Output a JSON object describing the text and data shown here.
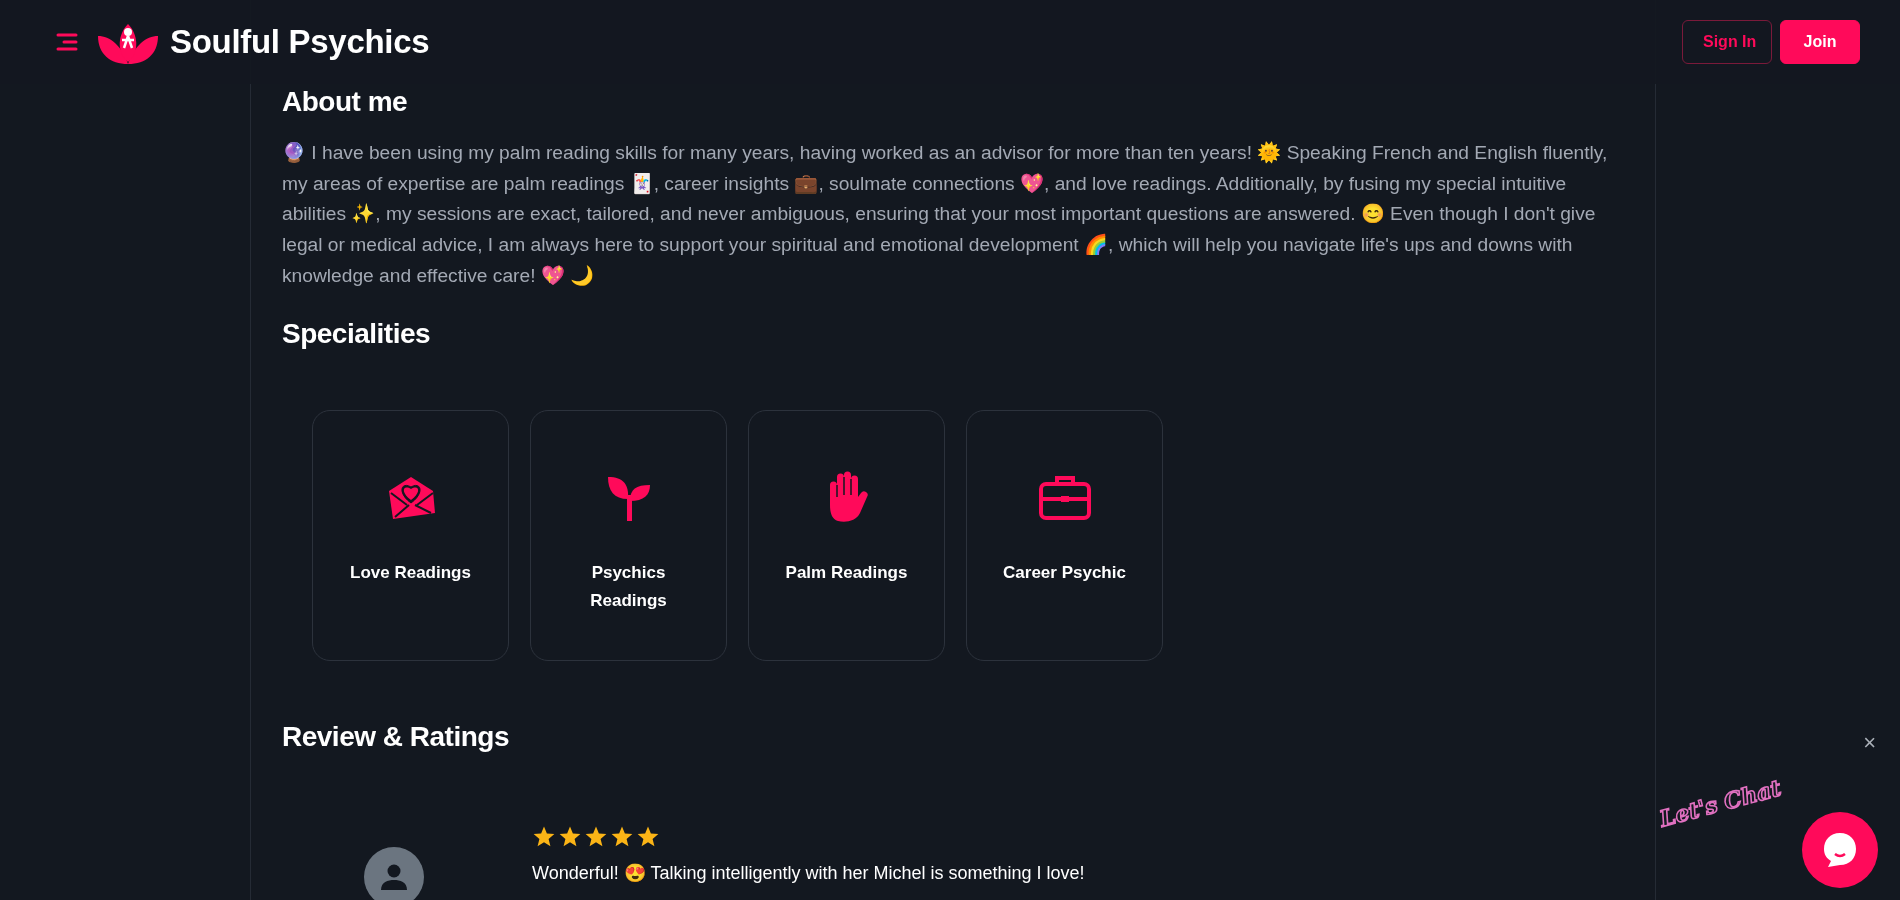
{
  "header": {
    "brand": "Soulful Psychics",
    "buttons": [
      {
        "label": "Sign In",
        "kind": "outline"
      },
      {
        "label": "Join",
        "kind": "solid"
      }
    ]
  },
  "about": {
    "heading": "About me",
    "text": "🔮 I have been using my palm reading skills for many years, having worked as an advisor for more than ten years! 🌞 Speaking French and English fluently, my areas of expertise are palm readings 🃏, career insights 💼, soulmate connections 💖, and love readings. Additionally, by fusing my special intuitive abilities ✨, my sessions are exact, tailored, and never ambiguous, ensuring that your most important questions are answered. 😊 Even though I don't give legal or medical advice, I am always here to support your spiritual and emotional development 🌈, which will help you navigate life's ups and downs with knowledge and effective care! 💖 🌙"
  },
  "specialities": {
    "heading": "Specialities",
    "items": [
      {
        "label": "Love Readings",
        "kind": "love"
      },
      {
        "label": "Psychics Readings",
        "kind": "sprout"
      },
      {
        "label": "Palm Readings",
        "kind": "palm"
      },
      {
        "label": "Career Psychic",
        "kind": "career"
      }
    ]
  },
  "reviews": {
    "heading": "Review & Ratings",
    "items": [
      {
        "stars": 5,
        "text": "Wonderful! 😍 Talking intelligently with her Michel is something I love!"
      }
    ]
  },
  "chat": {
    "label": "Let's Chat",
    "close": "×"
  }
}
